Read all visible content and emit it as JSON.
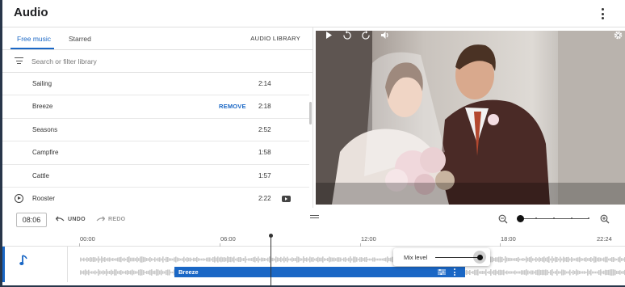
{
  "header": {
    "title": "Audio",
    "more_icon": "more-vert-icon"
  },
  "library": {
    "tabs": [
      {
        "label": "Free music",
        "active": true
      },
      {
        "label": "Starred",
        "active": false
      }
    ],
    "audio_library_label": "AUDIO LIBRARY",
    "search": {
      "placeholder": "Search or filter library",
      "value": ""
    },
    "tracks": [
      {
        "name": "Sailing",
        "duration": "2:14"
      },
      {
        "name": "Breeze",
        "duration": "2:18",
        "action": "REMOVE"
      },
      {
        "name": "Seasons",
        "duration": "2:52"
      },
      {
        "name": "Campfire",
        "duration": "1:58"
      },
      {
        "name": "Cattle",
        "duration": "1:57"
      },
      {
        "name": "Rooster",
        "duration": "2:22"
      }
    ]
  },
  "toolbar": {
    "current_time": "08:06",
    "undo_label": "UNDO",
    "redo_label": "REDO",
    "zoom_level": 0
  },
  "timeline": {
    "ruler_labels": [
      "00:00",
      "06:00",
      "12:00",
      "18:00",
      "22:24"
    ],
    "clip": {
      "name": "Breeze"
    },
    "mix": {
      "label": "Mix level",
      "level": 1.0
    }
  },
  "colors": {
    "accent": "#1a67c5",
    "frame": "#28364a"
  }
}
